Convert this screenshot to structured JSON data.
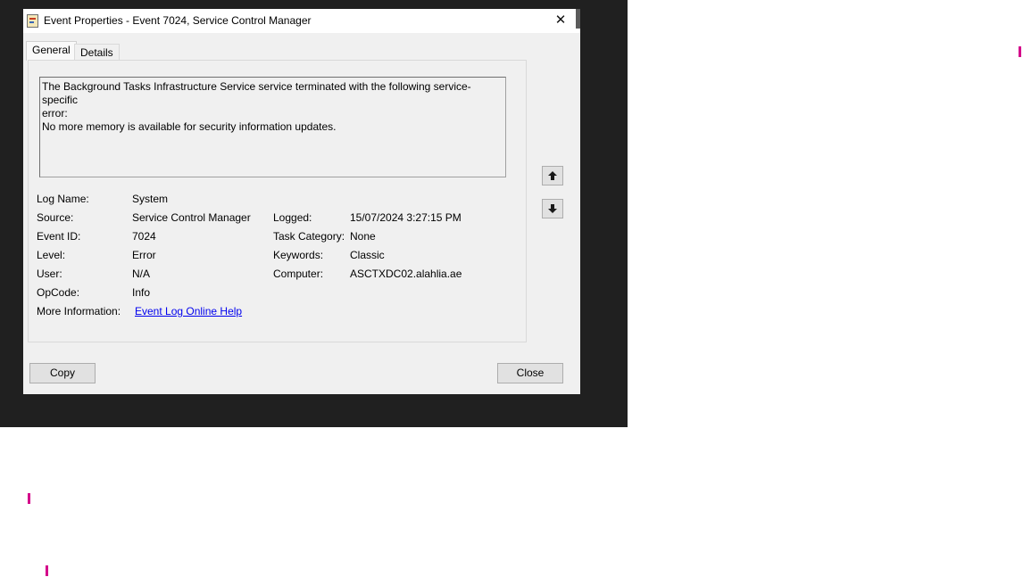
{
  "window": {
    "title": "Event Properties - Event 7024, Service Control Manager",
    "close_symbol": "✕",
    "app_icon": "event-viewer-icon"
  },
  "tabs": [
    {
      "label": "General",
      "selected": true
    },
    {
      "label": "Details",
      "selected": false
    }
  ],
  "description": {
    "line1": "The Background Tasks Infrastructure Service service terminated with the following service-specific",
    "line2": "error:",
    "line3": "No more memory is available for security information updates."
  },
  "details": {
    "log_name": {
      "label": "Log Name:",
      "value": "System"
    },
    "source": {
      "label": "Source:",
      "value": "Service Control Manager"
    },
    "logged": {
      "label": "Logged:",
      "value": "15/07/2024 3:27:15 PM"
    },
    "event_id": {
      "label": "Event ID:",
      "value": "7024"
    },
    "task_category": {
      "label": "Task Category:",
      "value": "None"
    },
    "level": {
      "label": "Level:",
      "value": "Error"
    },
    "keywords": {
      "label": "Keywords:",
      "value": "Classic"
    },
    "user": {
      "label": "User:",
      "value": "N/A"
    },
    "computer": {
      "label": "Computer:",
      "value": "ASCTXDC02.alahlia.ae"
    },
    "opcode": {
      "label": "OpCode:",
      "value": "Info"
    },
    "more_info": {
      "label": "More Information:",
      "link": "Event Log Online Help"
    }
  },
  "nav": {
    "up_icon": "arrow-up-icon",
    "down_icon": "arrow-down-icon"
  },
  "buttons": {
    "copy": "Copy",
    "close": "Close"
  },
  "colors": {
    "accent_marker": "#d4008a",
    "link": "#0000ee",
    "backdrop": "#202020"
  }
}
